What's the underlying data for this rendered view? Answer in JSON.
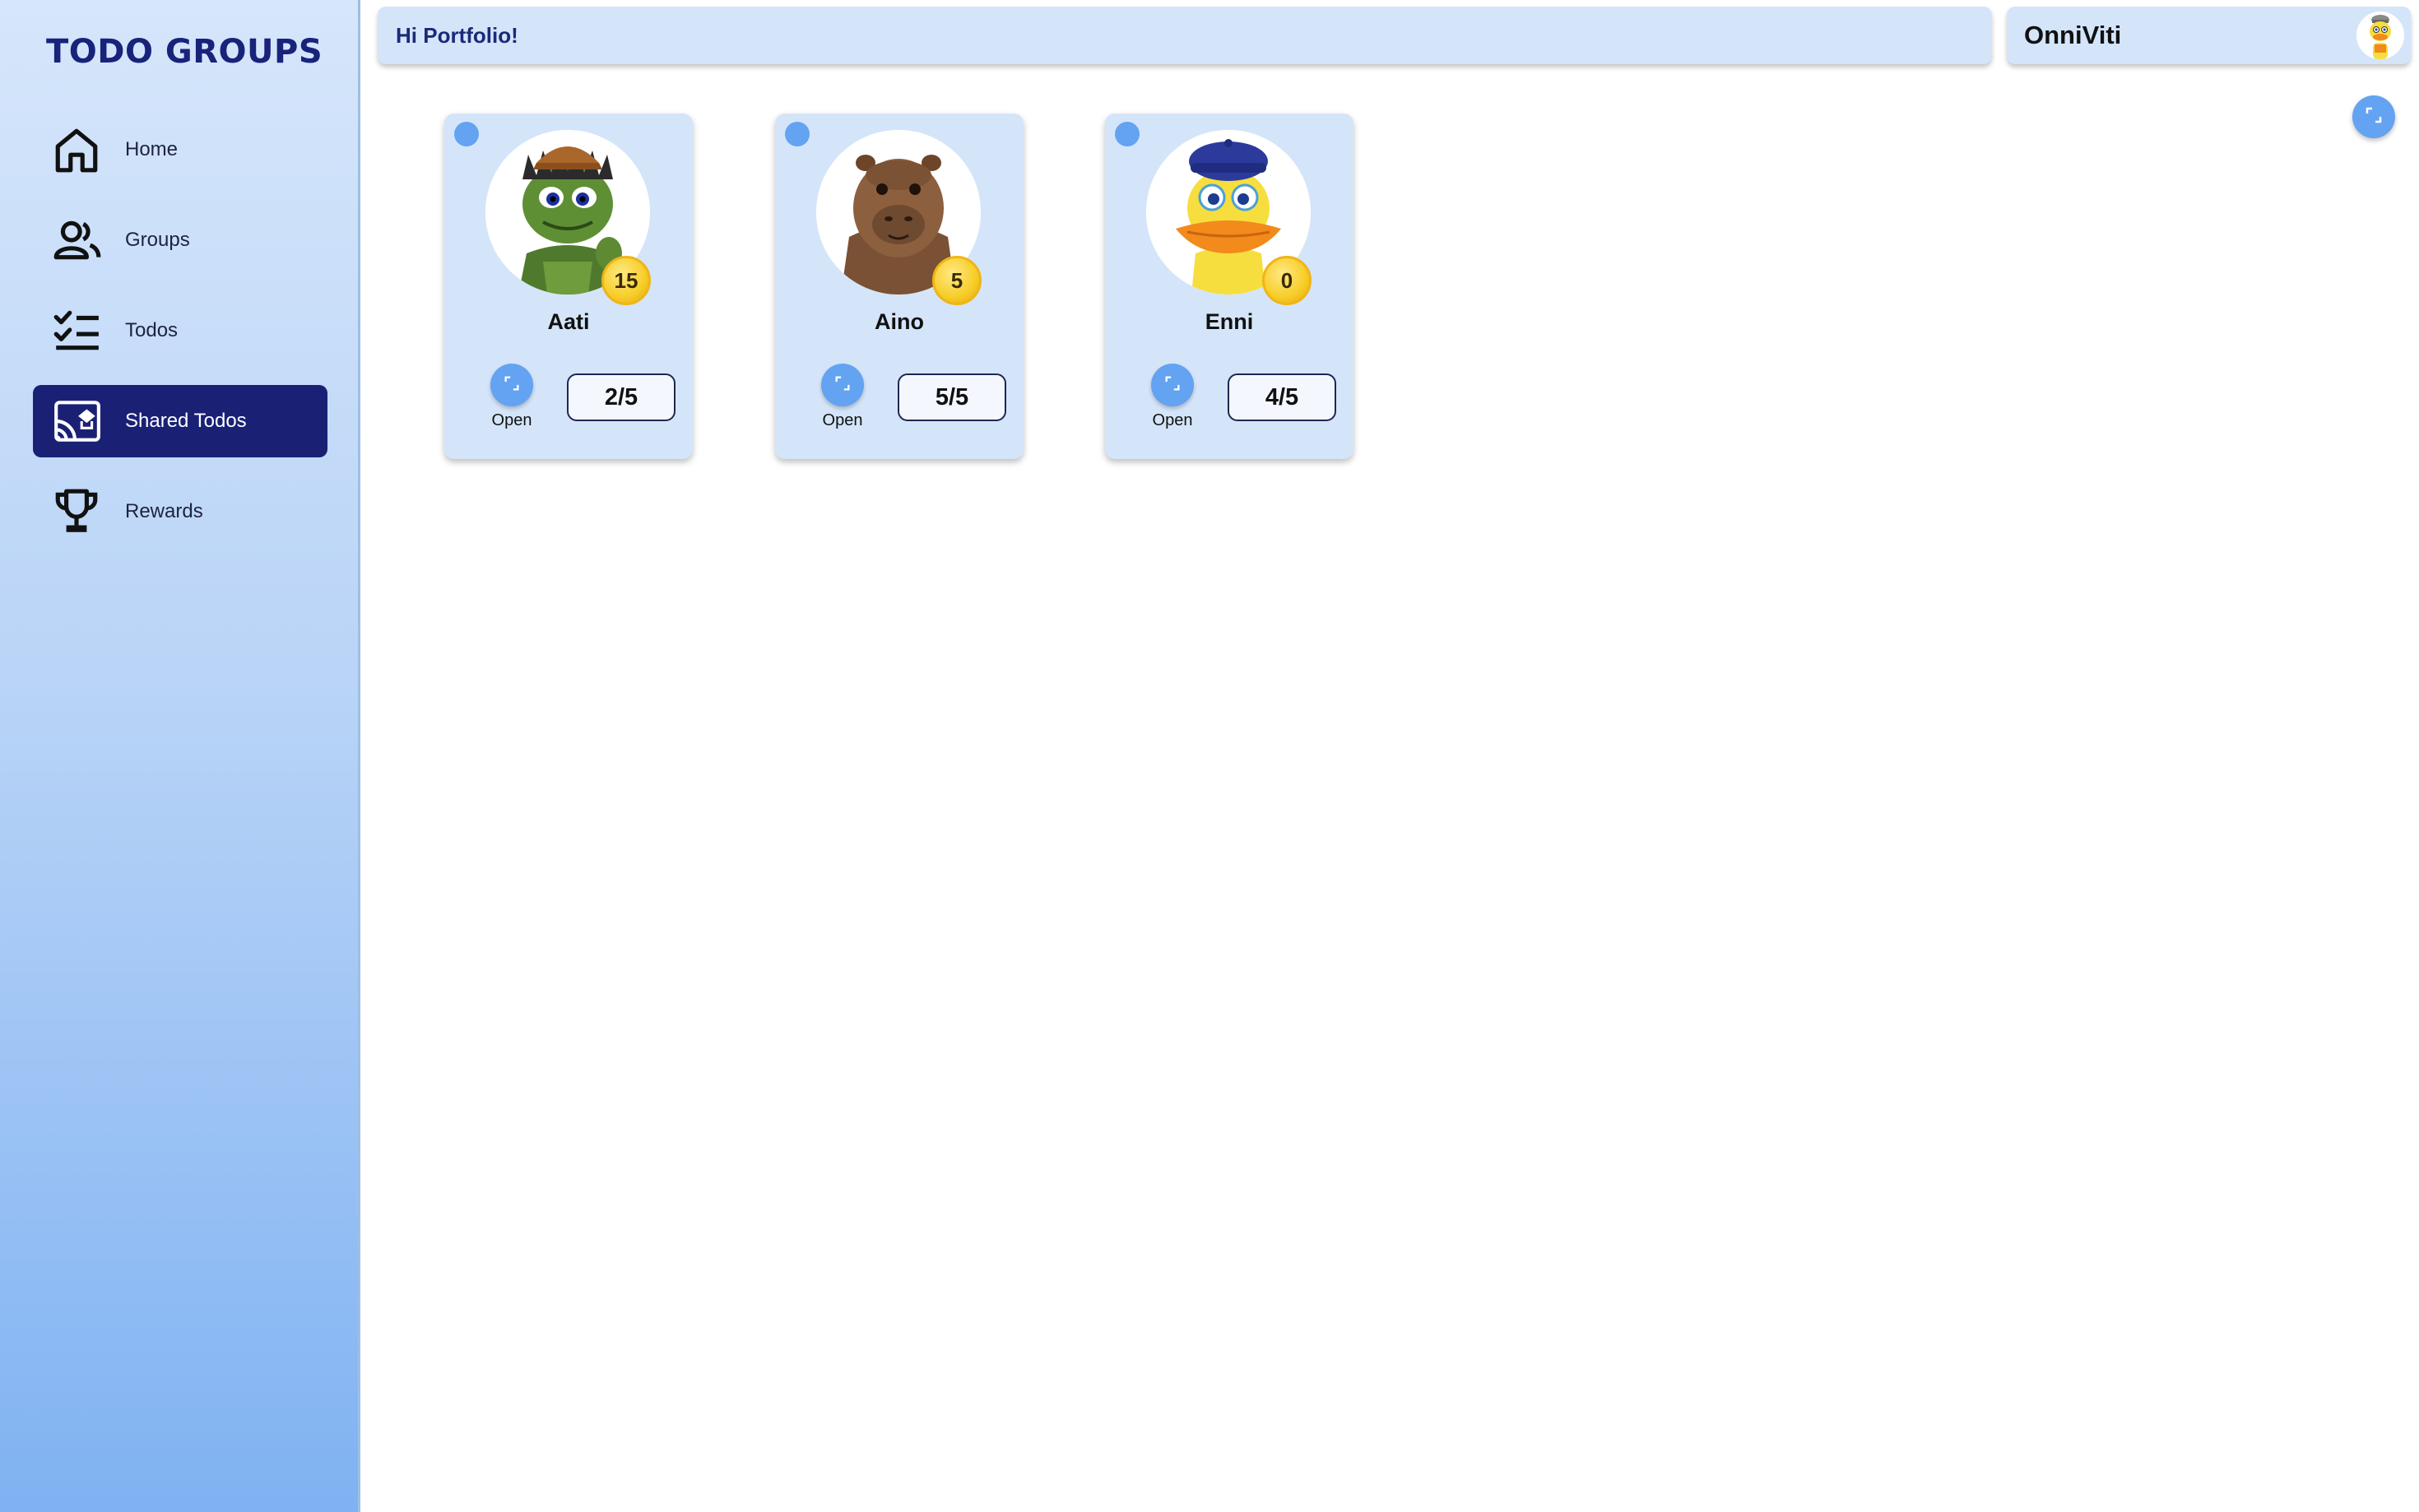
{
  "app": {
    "brand": "TODO GROUPS"
  },
  "sidebar": {
    "items": [
      {
        "label": "Home",
        "icon": "home-icon",
        "active": false
      },
      {
        "label": "Groups",
        "icon": "users-icon",
        "active": false
      },
      {
        "label": "Todos",
        "icon": "checklist-icon",
        "active": false
      },
      {
        "label": "Shared Todos",
        "icon": "shared-todos-icon",
        "active": true
      },
      {
        "label": "Rewards",
        "icon": "trophy-icon",
        "active": false
      }
    ]
  },
  "header": {
    "greeting": "Hi Portfolio!",
    "username": "OnniViti",
    "avatar_icon": "duck-avatar-icon"
  },
  "expand_icon": "expand-icon",
  "members": [
    {
      "name": "Aati",
      "coins": "15",
      "progress": "2/5",
      "open_label": "Open",
      "avatar_icon": "turtle-avatar-icon"
    },
    {
      "name": "Aino",
      "coins": "5",
      "progress": "5/5",
      "open_label": "Open",
      "avatar_icon": "capybara-avatar-icon"
    },
    {
      "name": "Enni",
      "coins": "0",
      "progress": "4/5",
      "open_label": "Open",
      "avatar_icon": "duck-avatar-icon"
    }
  ],
  "colors": {
    "brand_navy": "#1a2175",
    "card_bg": "#d4e5fa",
    "accent_blue": "#63a3f1",
    "coin_gold": "#f7cd27"
  }
}
